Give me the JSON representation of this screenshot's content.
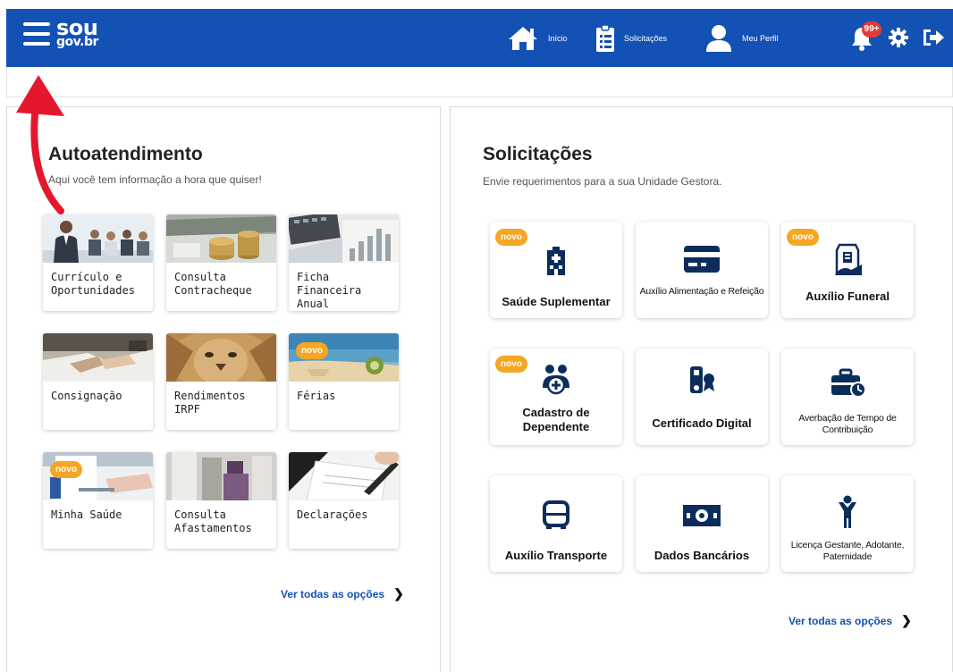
{
  "header": {
    "logo_line1": "sou",
    "logo_line2": "gov.br",
    "nav": [
      {
        "label": "Início",
        "icon": "home-icon"
      },
      {
        "label": "Solicitações",
        "icon": "clipboard-icon"
      },
      {
        "label": "Meu Perfil",
        "icon": "user-icon"
      }
    ],
    "notification_count": "99+",
    "icons": [
      "menu-icon",
      "bell-icon",
      "gear-icon",
      "logout-icon"
    ]
  },
  "colors": {
    "brand_blue": "#1351b4",
    "badge_orange": "#f5a623",
    "annotation_red": "#e5172f",
    "notification_red": "#e53935"
  },
  "autoatendimento": {
    "title": "Autoatendimento",
    "subtitle": "Aqui você tem informação a hora que quiser!",
    "cards": [
      {
        "label": "Currículo e Oportunidades",
        "badge": ""
      },
      {
        "label": "Consulta Contracheque",
        "badge": ""
      },
      {
        "label": "Ficha Financeira Anual",
        "badge": ""
      },
      {
        "label": "Consignação",
        "badge": ""
      },
      {
        "label": "Rendimentos IRPF",
        "badge": ""
      },
      {
        "label": "Férias",
        "badge": "novo"
      },
      {
        "label": "Minha Saúde",
        "badge": "novo"
      },
      {
        "label": "Consulta Afastamentos",
        "badge": ""
      },
      {
        "label": "Declarações",
        "badge": ""
      }
    ],
    "see_all": "Ver todas as opções"
  },
  "solicitacoes": {
    "title": "Solicitações",
    "subtitle": "Envie requerimentos para a sua Unidade Gestora.",
    "cards": [
      {
        "label": "Saúde Suplementar",
        "icon": "hospital-icon",
        "badge": "novo"
      },
      {
        "label": "Auxílio Alimentação e Refeição",
        "icon": "card-icon",
        "badge": ""
      },
      {
        "label": "Auxílio Funeral",
        "icon": "funeral-icon",
        "badge": "novo"
      },
      {
        "label": "Cadastro de Dependente",
        "icon": "dependents-icon",
        "badge": "novo"
      },
      {
        "label": "Certificado Digital",
        "icon": "certificate-icon",
        "badge": ""
      },
      {
        "label": "Averbação de Tempo de Contribuição",
        "icon": "briefcase-clock-icon",
        "badge": ""
      },
      {
        "label": "Auxílio Transporte",
        "icon": "bus-icon",
        "badge": ""
      },
      {
        "label": "Dados Bancários",
        "icon": "money-icon",
        "badge": ""
      },
      {
        "label": "Licença Gestante, Adotante, Paternidade",
        "icon": "child-icon",
        "badge": ""
      }
    ],
    "see_all": "Ver todas as opções"
  }
}
